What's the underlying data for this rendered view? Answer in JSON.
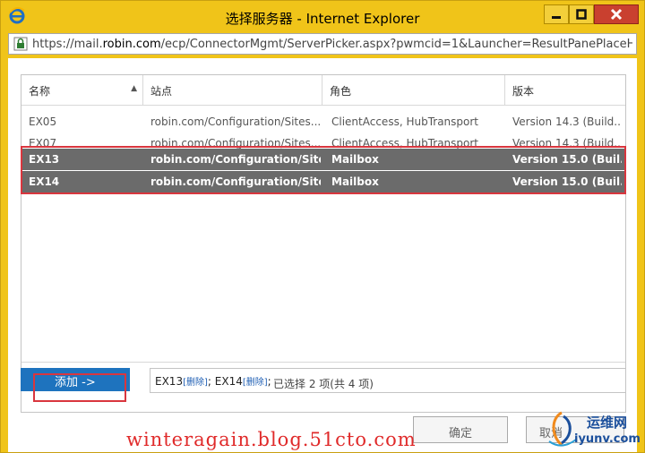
{
  "window": {
    "title": "选择服务器 - Internet Explorer",
    "url_prefix": "https://mail.",
    "url_domain": "robin.com",
    "url_path": "/ecp/ConnectorMgmt/ServerPicker.aspx?pwmcid=1&Launcher=ResultPanePlaceHc"
  },
  "grid": {
    "columns": [
      "名称",
      "站点",
      "角色",
      "版本"
    ],
    "sort_indicator": "▲",
    "rows": [
      {
        "name": "EX05",
        "site": "robin.com/Configuration/Sites...",
        "role": "ClientAccess, HubTransport",
        "version": "Version 14.3 (Build...",
        "selected": false
      },
      {
        "name": "EX07",
        "site": "robin.com/Configuration/Sites...",
        "role": "ClientAccess, HubTransport",
        "version": "Version 14.3 (Build...",
        "selected": false
      },
      {
        "name": "EX13",
        "site": "robin.com/Configuration/Site...",
        "role": "Mailbox",
        "version": "Version 15.0 (Buil...",
        "selected": true
      },
      {
        "name": "EX14",
        "site": "robin.com/Configuration/Site...",
        "role": "Mailbox",
        "version": "Version 15.0 (Buil...",
        "selected": true
      }
    ],
    "status": "已选择 2 项(共 4 项)"
  },
  "add_button": "添加 ->",
  "selected": {
    "item1": "EX13",
    "item2": "EX14",
    "remove_label": "[删除]",
    "separator": ";",
    "trailing": ";"
  },
  "ok_button": "确定",
  "cancel_button": "取消",
  "watermark": {
    "blog": "winteragain.blog.51cto.com",
    "logo_cn": "运维网",
    "logo_en": "iyunv.com"
  },
  "colors": {
    "title_bar": "#f0c419",
    "selected_row": "#6b6b6b",
    "highlight": "#d9363e",
    "add_button": "#1e73be"
  }
}
